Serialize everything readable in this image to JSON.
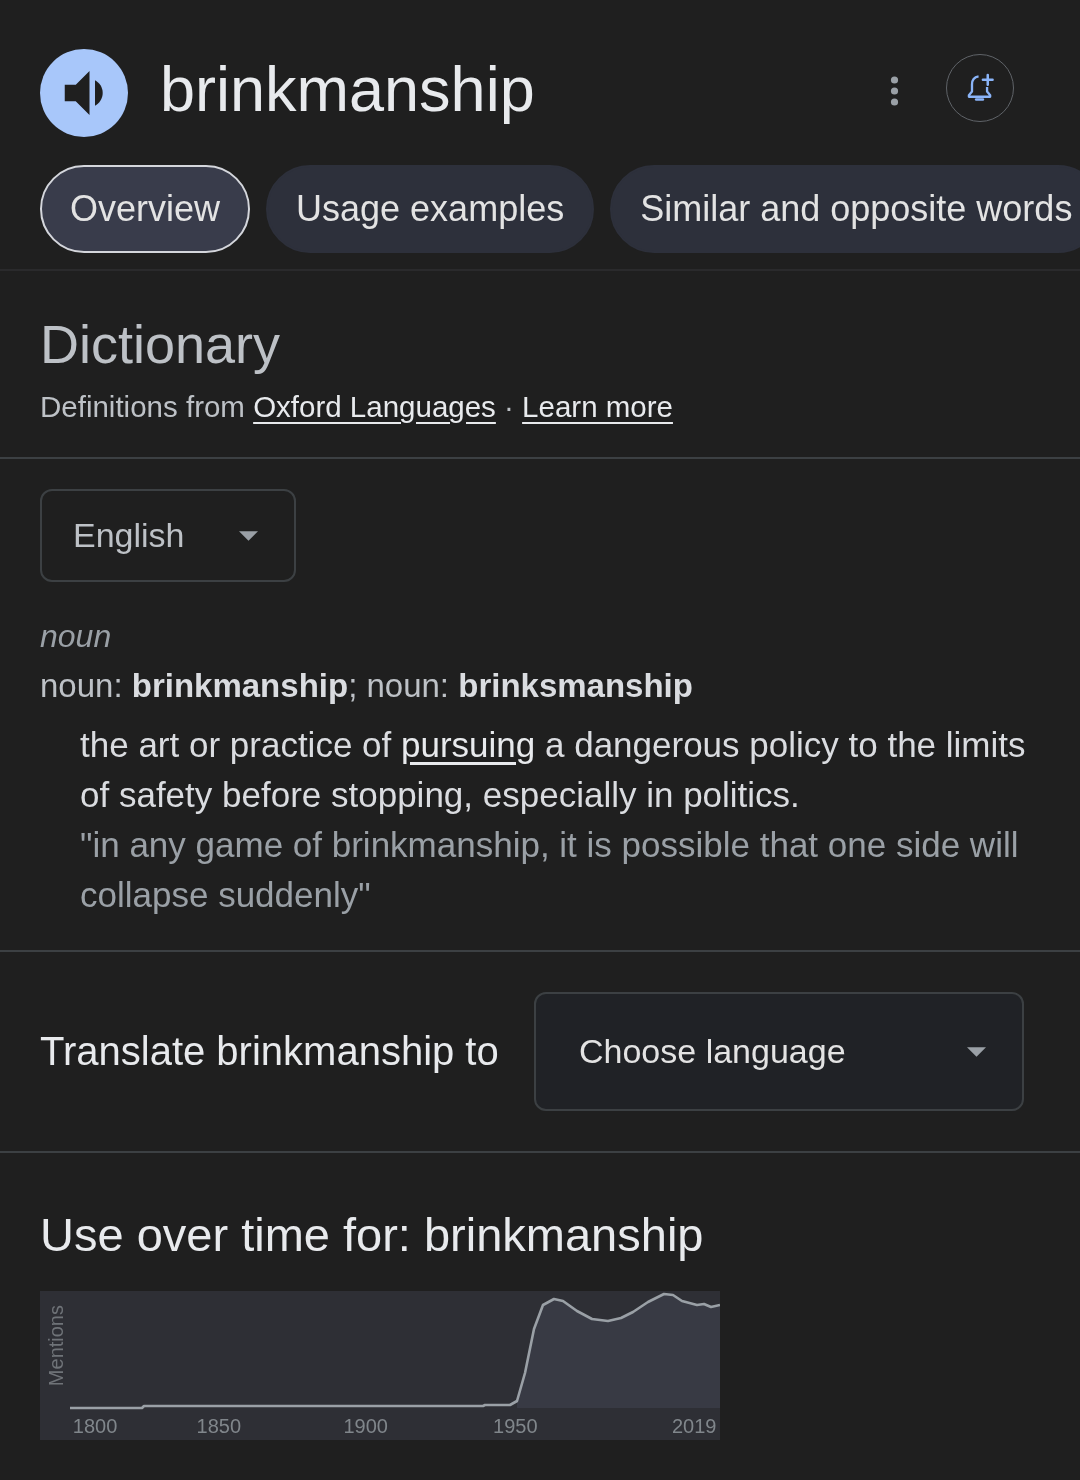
{
  "header": {
    "word": "brinkmanship"
  },
  "tabs": [
    {
      "label": "Overview",
      "selected": true
    },
    {
      "label": "Usage examples",
      "selected": false
    },
    {
      "label": "Similar and opposite words",
      "selected": false
    }
  ],
  "dictionary": {
    "title": "Dictionary",
    "source": [
      {
        "kind": "text",
        "text": "Definitions from "
      },
      {
        "kind": "link",
        "text": "Oxford Languages"
      },
      {
        "kind": "text",
        "text": " · "
      },
      {
        "kind": "link",
        "text": "Learn more"
      }
    ],
    "language": {
      "value": "English"
    },
    "entries": [
      {
        "part_of_speech": "noun",
        "forms": "noun: **brinkmanship**; noun: **brinksmanship**",
        "definitions": [
          {
            "parts": [
              {
                "kind": "text",
                "text": "the art or practice of "
              },
              {
                "kind": "link",
                "text": "pursuing"
              },
              {
                "kind": "text",
                "text": " a dangerous policy to the limits of safety before stopping, especially in politics."
              }
            ],
            "example": "\"in any game of brinkmanship, it is possible that one side will collapse suddenly\""
          }
        ]
      }
    ]
  },
  "translate": {
    "label": "Translate brinkmanship to",
    "select": {
      "value": "Choose language"
    }
  },
  "usage": {
    "title": "Use over time for: brinkmanship",
    "ylabel": "Mentions",
    "xlabels": [
      "1800",
      "1850",
      "1900",
      "1950",
      "2019"
    ]
  }
}
